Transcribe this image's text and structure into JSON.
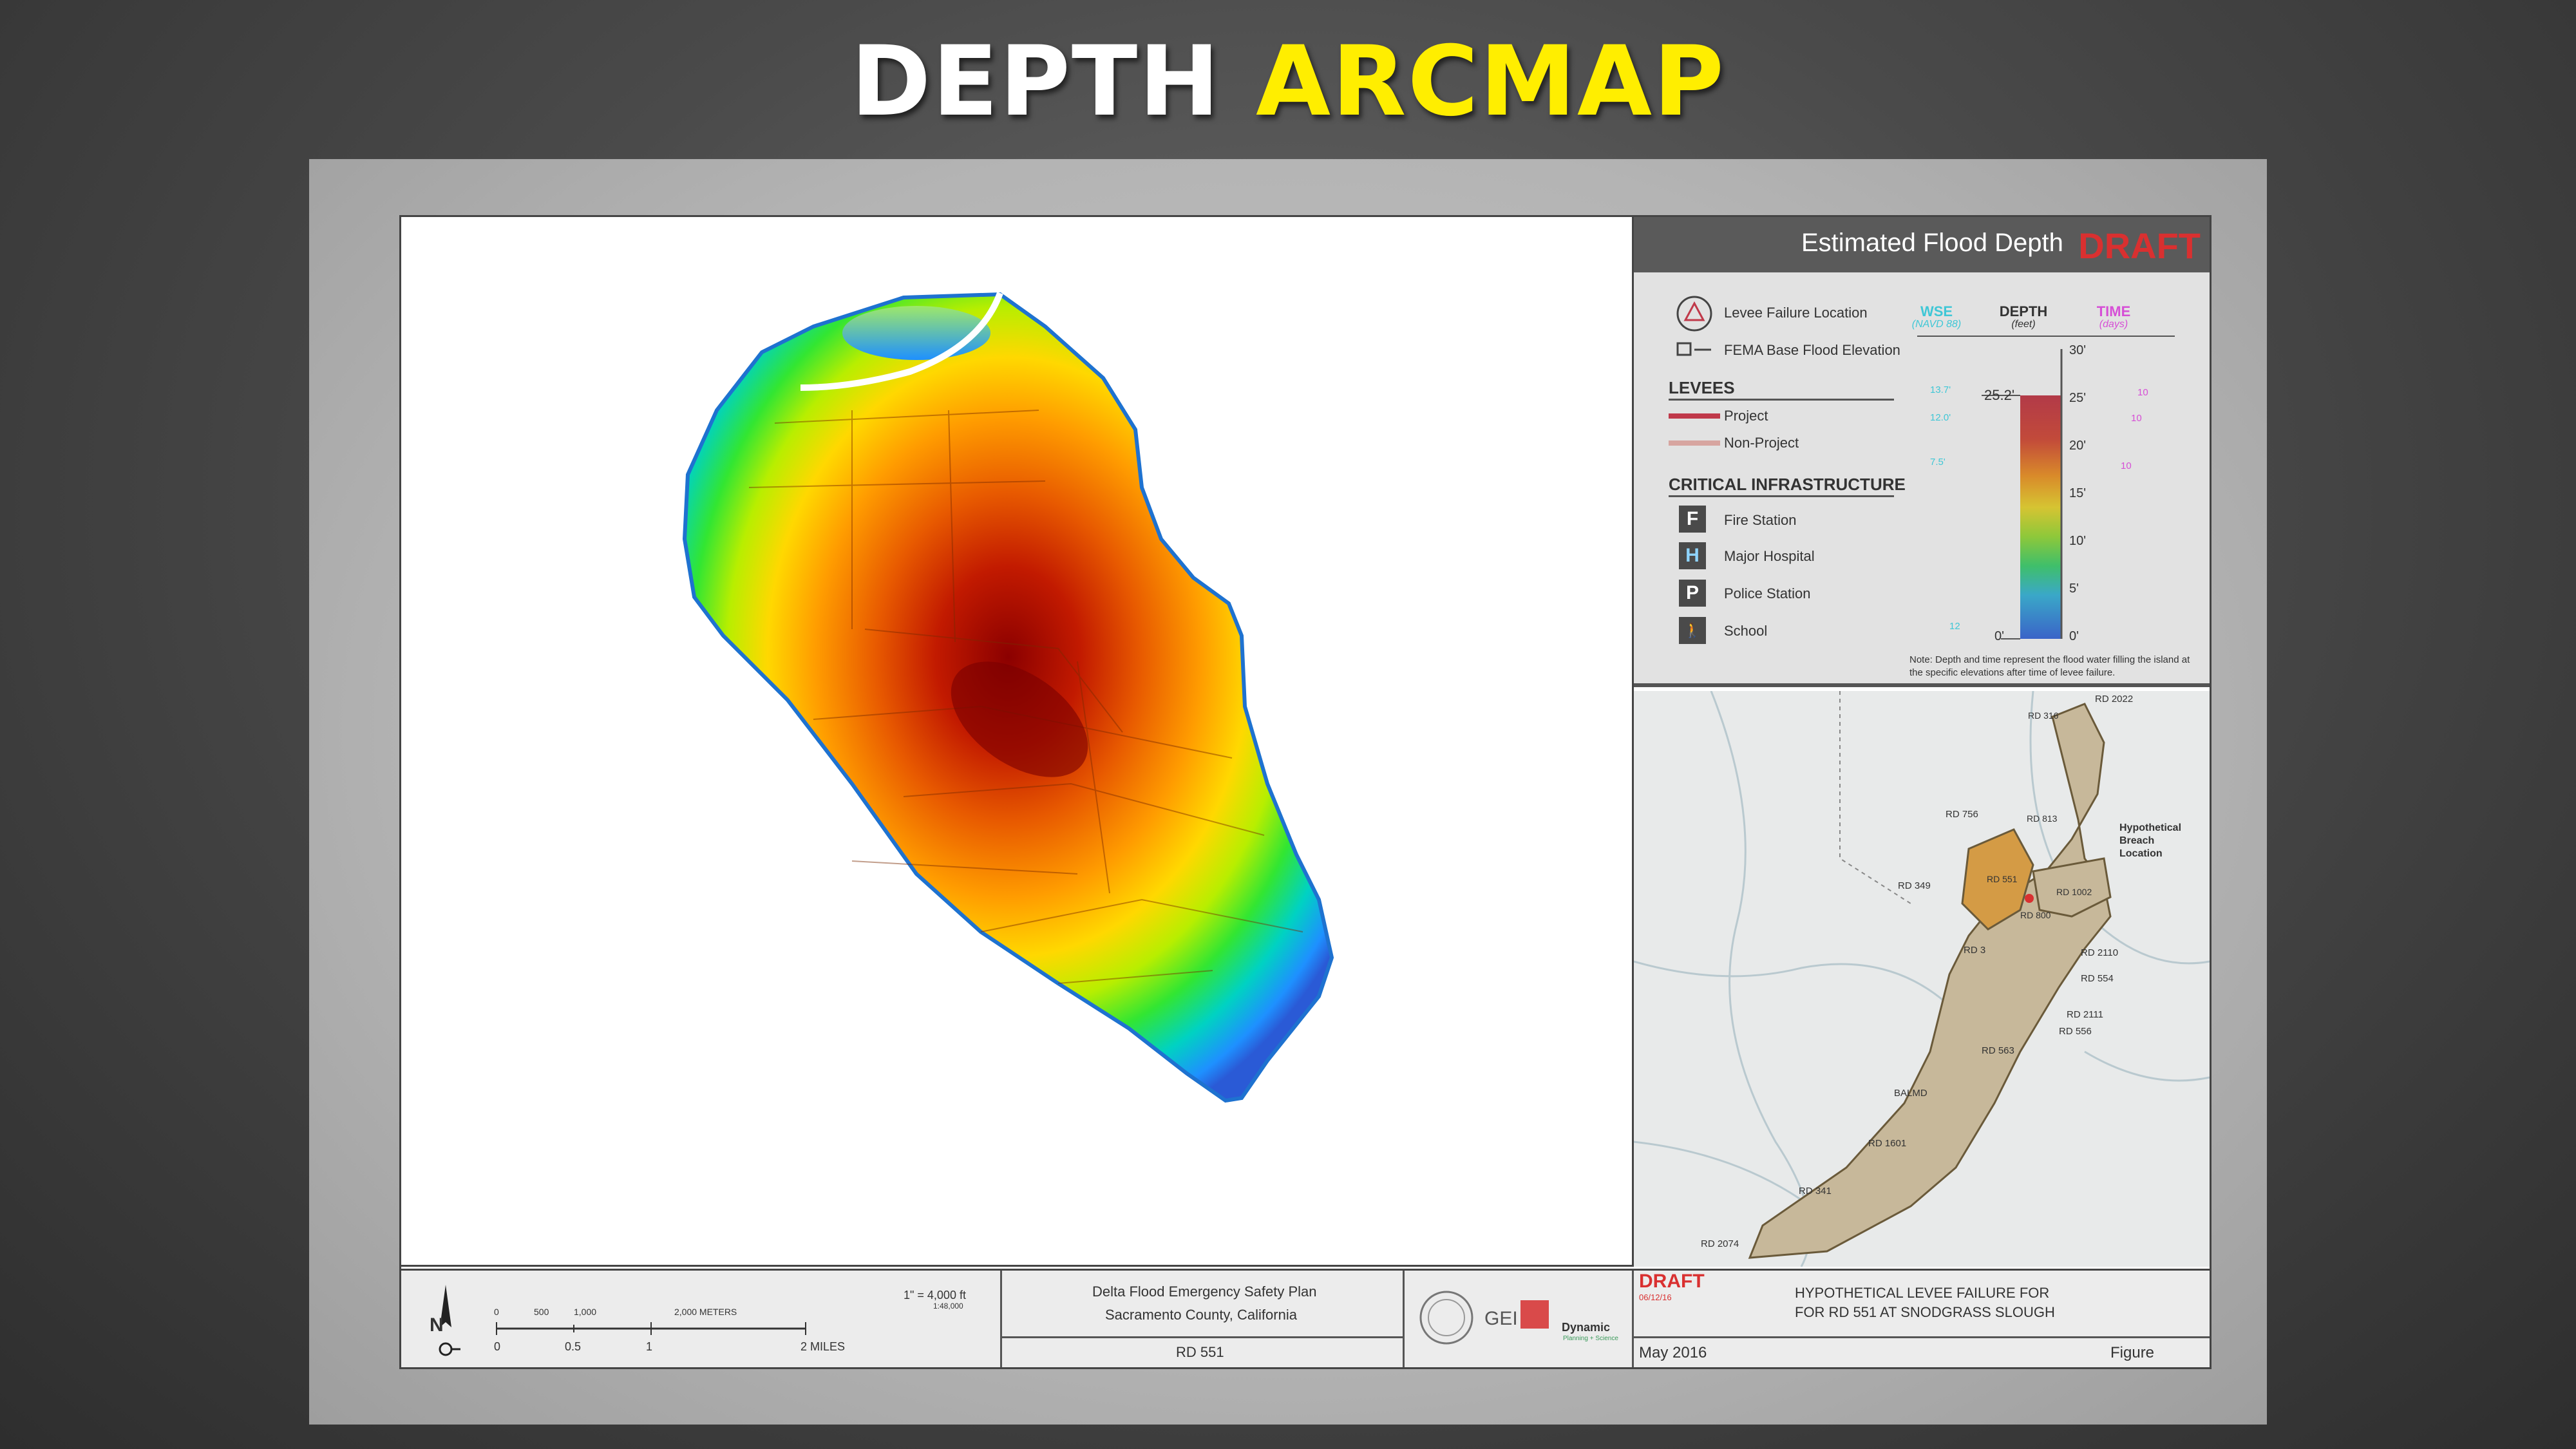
{
  "slide": {
    "title_white": "DEPTH",
    "title_yellow": "ARCMAP"
  },
  "legend": {
    "title": "Estimated Flood Depth",
    "draft": "DRAFT",
    "symbols": {
      "levee_failure": "Levee Failure Location",
      "fema_bfe": "FEMA Base Flood Elevation"
    },
    "levees_heading": "LEVEES",
    "levees": [
      {
        "label": "Project",
        "color": "#c0394a"
      },
      {
        "label": "Non-Project",
        "color": "#d7a5a0"
      }
    ],
    "infra_heading": "CRITICAL INFRASTRUCTURE",
    "infrastructure": [
      {
        "icon": "F",
        "label": "Fire Station",
        "icon_name": "fire-station-icon"
      },
      {
        "icon": "H",
        "label": "Major Hospital",
        "icon_name": "hospital-icon"
      },
      {
        "icon": "P",
        "label": "Police Station",
        "icon_name": "police-station-icon"
      },
      {
        "icon": "🚶",
        "label": "School",
        "icon_name": "school-icon"
      }
    ],
    "columns": {
      "wse": "WSE",
      "wse_sub": "(NAVD 88)",
      "depth": "DEPTH",
      "depth_sub": "(feet)",
      "time": "TIME",
      "time_sub": "(days)"
    },
    "depth_ticks": [
      "30'",
      "25'",
      "20'",
      "15'",
      "10'",
      "5'",
      "0'"
    ],
    "depth_zero_left": "0'",
    "depth_marker": "25.2'",
    "wse_values": [
      "13.7'",
      "12.0'",
      "7.5'",
      "12"
    ],
    "time_values": [
      "10",
      "10",
      "10"
    ],
    "note": "Note: Depth and time represent the flood water filling the island at the specific elevations after time of levee failure.",
    "colors": {
      "wse": "#3fc7d6",
      "time": "#d64fd6",
      "draft": "#d93030"
    }
  },
  "locator": {
    "labels": [
      "RD 2022",
      "RD 316",
      "RD 756",
      "RD 813",
      "Hypothetical",
      "Breach",
      "Location",
      "RD 349",
      "RD 551",
      "RD 1002",
      "RD 800",
      "RD 3",
      "RD 2110",
      "RD 554",
      "RD 2111",
      "RD 556",
      "RD 563",
      "BALMD",
      "RD 1601",
      "RD 341",
      "RD 2074"
    ]
  },
  "titleblock": {
    "scale_ratio": "1\" = 4,000 ft",
    "scale_ratio_sub": "1:48,000",
    "scale_meters": [
      "0",
      "500",
      "1,000",
      "2,000 METERS"
    ],
    "scale_miles": [
      "0",
      "0.5",
      "1",
      "2 MILES"
    ],
    "north": "N",
    "plan_line1": "Delta Flood Emergency Safety Plan",
    "plan_line2": "Sacramento County, California",
    "plan_rd": "RD 551",
    "logo_gei": "GEI",
    "logo_dynamic": "Dynamic",
    "logo_dynamic_sub": "Planning + Science",
    "draft": "DRAFT",
    "draft_date": "06/12/16",
    "description_line1": "HYPOTHETICAL LEVEE FAILURE FOR",
    "description_line2": "FOR RD 551 AT SNODGRASS SLOUGH",
    "date": "May 2016",
    "figure": "Figure"
  }
}
